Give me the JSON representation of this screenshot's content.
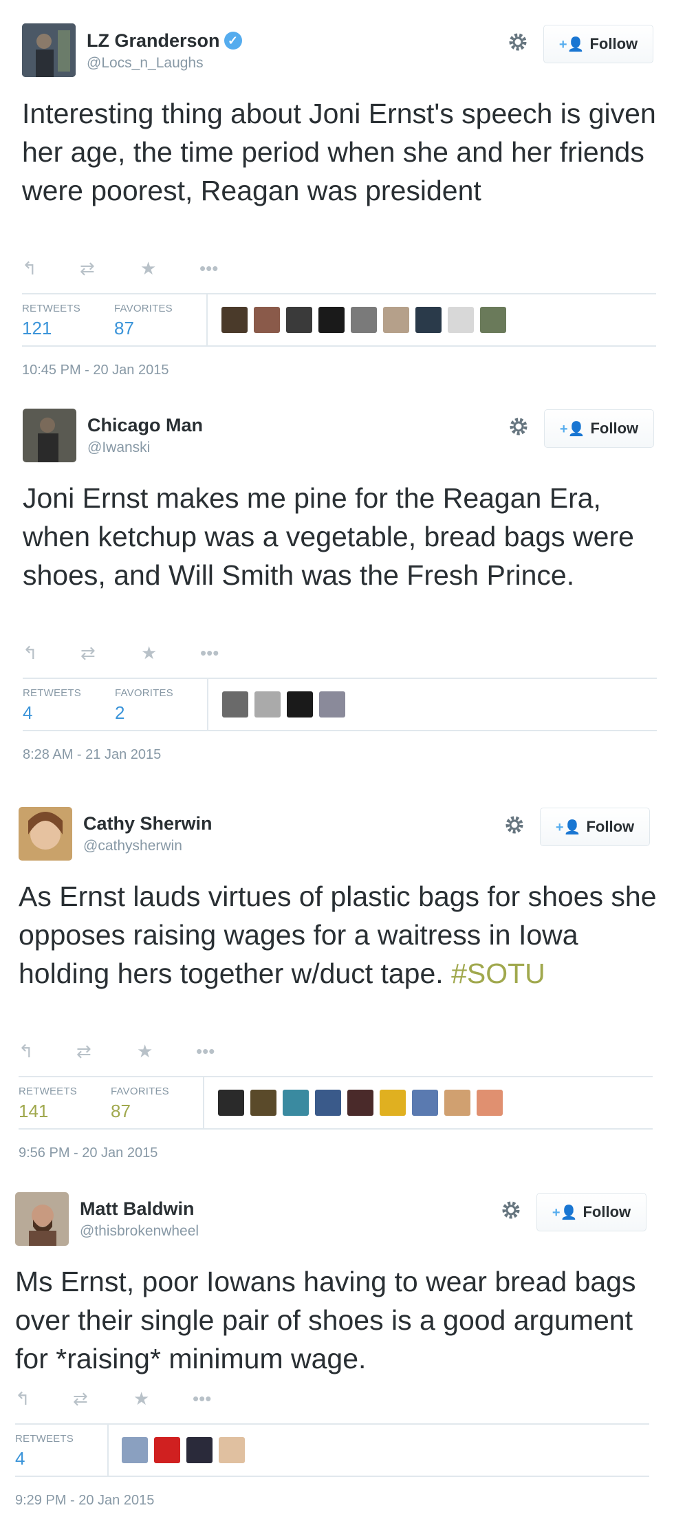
{
  "icons": {
    "reply": "reply-icon",
    "retweet": "retweet-icon",
    "favorite": "star-icon",
    "more": "more-dots-icon",
    "settings": "gear-icon",
    "follow": "add-user-icon",
    "verified": "verified-check-icon"
  },
  "colors": {
    "link": "#3b94d9",
    "hashtag": "#a0a84d",
    "muted": "#8899a6"
  },
  "tweets": [
    {
      "name": "LZ Granderson",
      "verified": true,
      "handle": "@Locs_n_Laughs",
      "follow_label": "Follow",
      "text": "Interesting thing about Joni Ernst's speech is given her age, the time period when she and her friends were poorest, Reagan was president",
      "retweets_label": "RETWEETS",
      "retweets": "121",
      "favorites_label": "FAVORITES",
      "favorites": "87",
      "timestamp": "10:45 PM - 20 Jan 2015"
    },
    {
      "name": "Chicago Man",
      "verified": false,
      "handle": "@Iwanski",
      "follow_label": "Follow",
      "text": "Joni Ernst makes me pine for the Reagan Era, when ketchup was a vegetable, bread bags were shoes, and Will Smith was the Fresh Prince.",
      "retweets_label": "RETWEETS",
      "retweets": "4",
      "favorites_label": "FAVORITES",
      "favorites": "2",
      "timestamp": "8:28 AM - 21 Jan 2015"
    },
    {
      "name": "Cathy Sherwin",
      "verified": false,
      "handle": "@cathysherwin",
      "follow_label": "Follow",
      "text": "As Ernst lauds virtues of plastic bags for shoes she opposes raising wages for a waitress in Iowa holding hers together w/duct tape. ",
      "hashtag": "#SOTU",
      "retweets_label": "RETWEETS",
      "retweets": "141",
      "favorites_label": "FAVORITES",
      "favorites": "87",
      "timestamp": "9:56 PM - 20 Jan 2015"
    },
    {
      "name": "Matt Baldwin",
      "verified": false,
      "handle": "@thisbrokenwheel",
      "follow_label": "Follow",
      "text": "Ms Ernst, poor Iowans having to wear bread bags over their single pair of shoes is a good argument for *raising* minimum wage.",
      "retweets_label": "RETWEETS",
      "retweets": "4",
      "timestamp": "9:29 PM - 20 Jan 2015"
    }
  ]
}
